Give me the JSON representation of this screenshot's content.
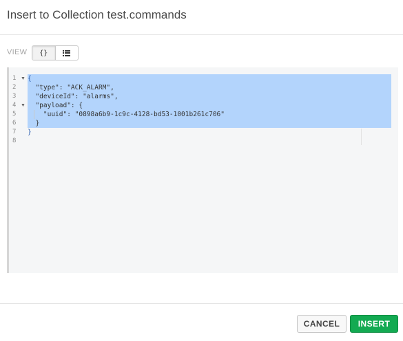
{
  "dialog": {
    "title": "Insert to Collection test.commands"
  },
  "view": {
    "label": "VIEW",
    "json_glyph": "{}",
    "json_icon": "braces-icon",
    "list_icon": "list-icon"
  },
  "editor": {
    "line_numbers": [
      "1",
      "2",
      "3",
      "4",
      "5",
      "6",
      "7",
      "8"
    ],
    "lines": [
      "{",
      "  \"type\": \"ACK_ALARM\",",
      "  \"deviceId\": \"alarms\",",
      "  \"payload\": {",
      "    \"uuid\": \"0898a6b9-1c9c-4128-bd53-1001b261c706\"",
      "  }",
      "}",
      ""
    ]
  },
  "buttons": {
    "cancel": "CANCEL",
    "insert": "INSERT"
  },
  "colors": {
    "insert_bg": "#13aa52",
    "selection": "#b3d4fc"
  }
}
